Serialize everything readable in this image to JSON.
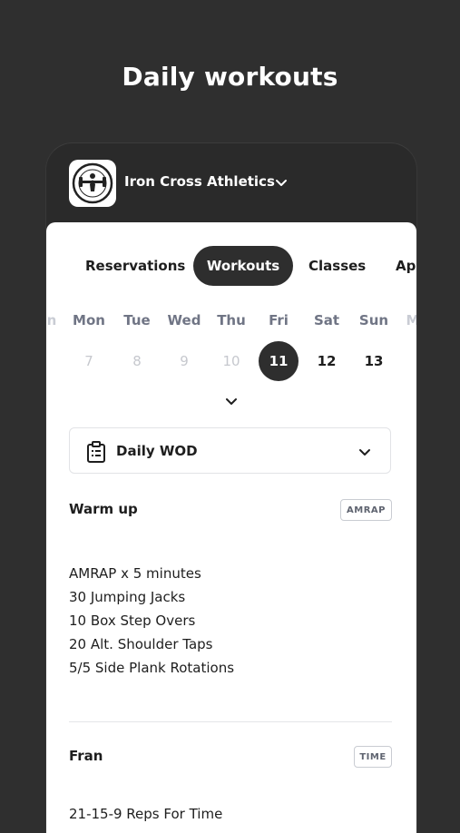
{
  "headline": "Daily workouts",
  "header": {
    "gym_name": "Iron Cross Athletics",
    "logo_icon": "gym-logo-badge",
    "chevron_icon": "chevron-down-icon"
  },
  "tabs": [
    "Reservations",
    "Workouts",
    "Classes",
    "Ap"
  ],
  "active_tab": "Workouts",
  "calendar": {
    "days": [
      {
        "name": "n",
        "num": ""
      },
      {
        "name": "Mon",
        "num": "7"
      },
      {
        "name": "Tue",
        "num": "8"
      },
      {
        "name": "Wed",
        "num": "9"
      },
      {
        "name": "Thu",
        "num": "10"
      },
      {
        "name": "Fri",
        "num": "11"
      },
      {
        "name": "Sat",
        "num": "12"
      },
      {
        "name": "Sun",
        "num": "13"
      },
      {
        "name": "M",
        "num": ""
      }
    ],
    "selected": "11"
  },
  "program": {
    "label": "Daily WOD",
    "icon": "clipboard-icon"
  },
  "sections": [
    {
      "title": "Warm up",
      "tag": "AMRAP",
      "lines": [
        "AMRAP x 5 minutes",
        "30 Jumping Jacks",
        "10 Box Step Overs",
        "20 Alt. Shoulder Taps",
        "5/5 Side Plank Rotations"
      ]
    },
    {
      "title": "Fran",
      "tag": "TIME",
      "lines": [
        "21-15-9 Reps For Time"
      ]
    }
  ],
  "colors": {
    "background": "#2f2f2f",
    "accent": "#2e2e2e",
    "card": "#ffffff"
  }
}
